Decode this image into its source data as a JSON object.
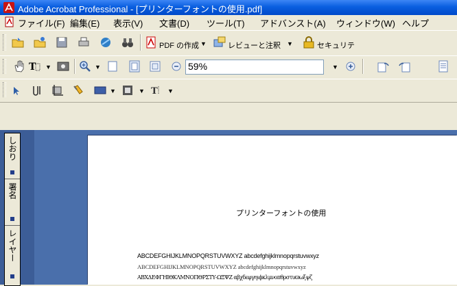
{
  "window": {
    "title": "Adobe Acrobat Professional - [プリンターフォントの使用.pdf]"
  },
  "menu": [
    {
      "label": "ファイル(F)"
    },
    {
      "label": "編集(E)"
    },
    {
      "label": "表示(V)"
    },
    {
      "label": "文書(D)"
    },
    {
      "label": "ツール(T)"
    },
    {
      "label": "アドバンスト(A)"
    },
    {
      "label": "ウィンドウ(W)"
    },
    {
      "label": "ヘルプ"
    }
  ],
  "toolbar1": {
    "create_pdf_label": "PDF の作成",
    "review_label": "レビューと注釈",
    "security_label": "セキュリテ"
  },
  "toolbar2": {
    "zoom_value": "59%"
  },
  "sidepanel": {
    "tabs": [
      {
        "label": "しおり"
      },
      {
        "label": "署名"
      },
      {
        "label": "レイヤー"
      }
    ]
  },
  "document": {
    "heading": "プリンターフォントの使用",
    "lines": [
      "ABCDEFGHIJKLMNOPQRSTUVWXYZ abcdefghijklmnopqrstuvwxyz",
      "ABCDEFGHIJKLMNOPQRSTUVWXYZ abcdefghijklmnopqrstuvwxyz",
      "ΑΒΧΔΕΦΓΗΙΘΚΛΜΝΟΠΘΡΣΤΥ-ΩΞΨΖ αβχδεφγηιϕκλμνοπθρστυϖωξψζ"
    ]
  },
  "colors": {
    "titlebar": "#0a5fe0",
    "toolbar_bg": "#ece9d8",
    "workspace": "#4a6fab",
    "sidepanel": "#3c5d97"
  }
}
